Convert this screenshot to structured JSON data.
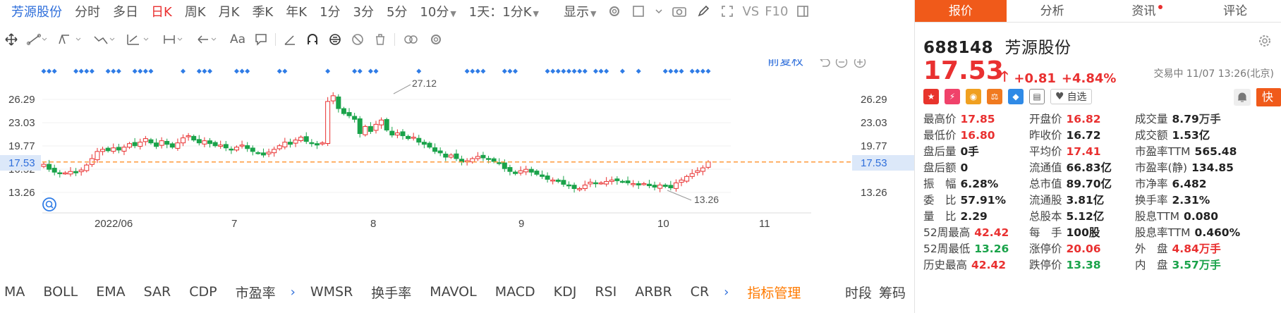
{
  "toolbar": {
    "name": "芳源股份",
    "periods": [
      "分时",
      "多日",
      "日K",
      "周K",
      "月K",
      "季K",
      "年K",
      "1分",
      "3分",
      "5分",
      "10分"
    ],
    "active_period": "日K",
    "interval": "1天：1分K",
    "display": "显示",
    "vs": "VS",
    "f10": "F10"
  },
  "drawing_tools": {
    "text_tool": "Aa"
  },
  "chart": {
    "adjust": "前复权",
    "icons": [
      "undo-icon",
      "zoom-out-icon",
      "zoom-in-icon"
    ],
    "y_ticks": [
      "26.29",
      "23.03",
      "19.77",
      "16.52",
      "13.26"
    ],
    "current_price_label": "17.53",
    "high_annotation": "27.12",
    "low_annotation": "13.26",
    "x_labels": [
      "2022/06",
      "7",
      "8",
      "9",
      "10",
      "11"
    ],
    "colors": {
      "up": "#e93030",
      "down": "#1aa34a",
      "line": "#ff9a3c",
      "marker": "#2f7ce6",
      "price_tag_bg": "#dce8f9"
    }
  },
  "chart_data": {
    "type": "candlestick",
    "title": "",
    "xlabel": "",
    "ylabel": "",
    "y_axis_ticks": [
      26.29,
      23.03,
      19.77,
      16.52,
      13.26
    ],
    "x_axis_labels": [
      "2022/06",
      "7",
      "8",
      "9",
      "10",
      "11"
    ],
    "current_price": 17.53,
    "annotations": [
      {
        "label": "27.12",
        "value": 27.12
      },
      {
        "label": "13.26",
        "value": 13.26
      }
    ],
    "closes": [
      17.2,
      16.5,
      16.1,
      15.9,
      16.0,
      16.2,
      16.0,
      16.4,
      17.1,
      18.0,
      19.0,
      19.3,
      19.1,
      19.5,
      19.2,
      19.6,
      20.1,
      19.8,
      20.3,
      20.8,
      20.2,
      19.7,
      20.5,
      20.0,
      19.6,
      20.2,
      20.9,
      21.2,
      20.6,
      20.2,
      20.5,
      20.1,
      19.8,
      19.9,
      19.5,
      19.2,
      19.6,
      19.9,
      19.4,
      19.0,
      18.8,
      18.5,
      18.9,
      19.3,
      19.8,
      20.3,
      20.0,
      20.6,
      21.0,
      20.4,
      20.1,
      19.9,
      20.2,
      26.0,
      26.8,
      25.0,
      24.3,
      24.0,
      23.5,
      21.5,
      22.5,
      21.8,
      22.8,
      23.4,
      22.0,
      21.3,
      21.6,
      21.2,
      20.8,
      21.0,
      20.3,
      20.0,
      19.6,
      19.0,
      18.8,
      18.2,
      18.5,
      18.0,
      17.5,
      17.7,
      18.0,
      18.3,
      18.1,
      17.9,
      17.6,
      17.4,
      16.6,
      16.2,
      15.9,
      16.3,
      16.5,
      16.1,
      15.8,
      15.5,
      15.1,
      15.0,
      14.8,
      14.4,
      14.2,
      13.8,
      13.8,
      14.3,
      14.7,
      14.5,
      14.6,
      14.8,
      15.0,
      14.9,
      14.8,
      14.6,
      14.5,
      14.3,
      14.5,
      14.2,
      14.0,
      14.3,
      14.1,
      13.9,
      14.6,
      15.0,
      15.5,
      15.9,
      16.3,
      16.7,
      17.53
    ],
    "marker_runs": [
      [
        0,
        2
      ],
      [
        6,
        7
      ],
      [
        8,
        9
      ],
      [
        12,
        14
      ],
      [
        17,
        20
      ],
      [
        26,
        26
      ],
      [
        29,
        30
      ],
      [
        31,
        31
      ],
      [
        36,
        36
      ],
      [
        37,
        38
      ],
      [
        44,
        45
      ],
      [
        53,
        53
      ],
      [
        58,
        59
      ],
      [
        61,
        62
      ],
      [
        70,
        70
      ],
      [
        79,
        79
      ],
      [
        80,
        82
      ],
      [
        86,
        88
      ],
      [
        94,
        97
      ],
      [
        98,
        101
      ],
      [
        103,
        105
      ],
      [
        108,
        108
      ],
      [
        111,
        111
      ],
      [
        116,
        119
      ],
      [
        121,
        124
      ]
    ]
  },
  "indicators": {
    "tabs": [
      "MA",
      "BOLL",
      "EMA",
      "SAR",
      "CDP",
      "市盈率",
      "WMSR",
      "换手率",
      "MAVOL",
      "MACD",
      "KDJ",
      "RSI",
      "ARBR",
      "CR"
    ],
    "manage": "指标管理",
    "right": [
      "时段",
      "筹码"
    ]
  },
  "panel": {
    "tabs": [
      "报价",
      "分析",
      "资讯",
      "评论"
    ],
    "active_tab": "报价",
    "code": "688148",
    "name": "芳源股份",
    "price": "17.53",
    "change": "+0.81",
    "change_pct": "+4.84%",
    "status": "交易中 11/07 13:26(北京)",
    "favorite": "自选",
    "quick_trade": "快捷交易",
    "rows": [
      [
        {
          "l": "最高价",
          "v": "17.85",
          "c": "up"
        },
        {
          "l": "开盘价",
          "v": "16.82",
          "c": "up"
        },
        {
          "l": "成交量",
          "v": "8.79",
          "u": "万手",
          "c": ""
        }
      ],
      [
        {
          "l": "最低价",
          "v": "16.80",
          "c": "up"
        },
        {
          "l": "昨收价",
          "v": "16.72",
          "c": ""
        },
        {
          "l": "成交额",
          "v": "1.53亿",
          "c": ""
        }
      ],
      [
        {
          "l": "盘后量",
          "v": "0手",
          "c": ""
        },
        {
          "l": "平均价",
          "v": "17.41",
          "c": "up"
        },
        {
          "l": "市盈率TTM",
          "v": "565.48",
          "c": ""
        }
      ],
      [
        {
          "l": "盘后额",
          "v": "0",
          "c": ""
        },
        {
          "l": "流通值",
          "v": "66.83亿",
          "c": ""
        },
        {
          "l": "市盈率(静)",
          "v": "134.85",
          "c": ""
        }
      ],
      [
        {
          "l": "振　幅",
          "v": "6.28%",
          "c": ""
        },
        {
          "l": "总市值",
          "v": "89.70亿",
          "c": ""
        },
        {
          "l": "市净率",
          "v": "6.482",
          "c": ""
        }
      ],
      [
        {
          "l": "委　比",
          "v": "57.91%",
          "c": ""
        },
        {
          "l": "流通股",
          "v": "3.81亿",
          "c": ""
        },
        {
          "l": "换手率",
          "v": "2.31%",
          "c": ""
        }
      ],
      [
        {
          "l": "量　比",
          "v": "2.29",
          "c": ""
        },
        {
          "l": "总股本",
          "v": "5.12亿",
          "c": ""
        },
        {
          "l": "股息TTM",
          "v": "0.080",
          "c": ""
        }
      ],
      [
        {
          "l": "52周最高",
          "v": "42.42",
          "c": "up"
        },
        {
          "l": "每　手",
          "v": "100股",
          "c": ""
        },
        {
          "l": "股息率TTM",
          "v": "0.460%",
          "c": ""
        }
      ],
      [
        {
          "l": "52周最低",
          "v": "13.26",
          "c": "dn"
        },
        {
          "l": "涨停价",
          "v": "20.06",
          "c": "up"
        },
        {
          "l": "外　盘",
          "v": "4.84万手",
          "c": "up"
        }
      ],
      [
        {
          "l": "历史最高",
          "v": "42.42",
          "c": "up"
        },
        {
          "l": "跌停价",
          "v": "13.38",
          "c": "dn"
        },
        {
          "l": "内　盘",
          "v": "3.57万手",
          "c": "dn"
        }
      ]
    ]
  }
}
